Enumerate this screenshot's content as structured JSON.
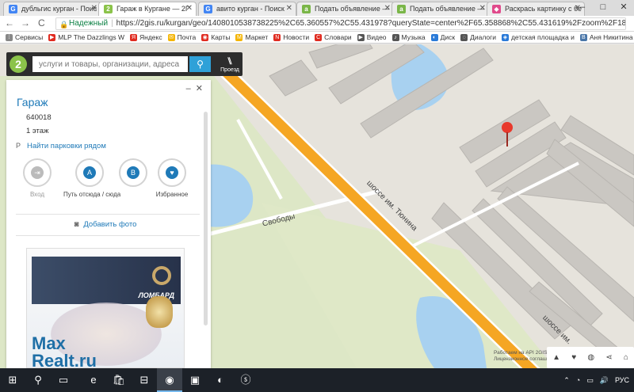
{
  "browser": {
    "tabs": [
      {
        "title": "дубльгис курган - Поис",
        "icon": "google-icon",
        "color": "#4285f4",
        "glyph": "G"
      },
      {
        "title": "Гараж в Кургане — 2Г",
        "icon": "2gis-icon",
        "color": "#8bc34a",
        "glyph": "2"
      },
      {
        "title": "авито курган - Поиск",
        "icon": "google-icon",
        "color": "#4285f4",
        "glyph": "G"
      },
      {
        "title": "Подать объявление —",
        "icon": "avito-icon",
        "color": "#7ab648",
        "glyph": "a"
      },
      {
        "title": "Подать объявление —",
        "icon": "avito-icon",
        "color": "#7ab648",
        "glyph": "a"
      },
      {
        "title": "Раскрась картинку с бе",
        "icon": "paint-icon",
        "color": "#e04a8b",
        "glyph": "◆"
      }
    ],
    "window_buttons": [
      "–",
      "□",
      "✕"
    ],
    "secure_label": "Надежный",
    "url": "https://2gis.ru/kurgan/geo/1408010538738225%2C65.360557%2C55.431978?queryState=center%2F65.358868%2C55.431619%2Fzoom%2F18",
    "nav": {
      "back": "←",
      "forward": "→",
      "reload": "C"
    }
  },
  "bookmarks": [
    {
      "label": "Сервисы",
      "color": "#888888",
      "glyph": "⁞"
    },
    {
      "label": "MLP The Dazzlings W",
      "color": "#e02b20",
      "glyph": "▶"
    },
    {
      "label": "Яндекс",
      "color": "#e02b20",
      "glyph": "Я"
    },
    {
      "label": "Почта",
      "color": "#f4b400",
      "glyph": "✉"
    },
    {
      "label": "Карты",
      "color": "#e02b20",
      "glyph": "◉"
    },
    {
      "label": "Маркет",
      "color": "#f4b400",
      "glyph": "M"
    },
    {
      "label": "Новости",
      "color": "#e02b20",
      "glyph": "N"
    },
    {
      "label": "Словари",
      "color": "#e02b20",
      "glyph": "С"
    },
    {
      "label": "Видео",
      "color": "#555555",
      "glyph": "▶"
    },
    {
      "label": "Музыка",
      "color": "#555555",
      "glyph": "♪"
    },
    {
      "label": "Диск",
      "color": "#2a7ad8",
      "glyph": "◐"
    },
    {
      "label": "Диалоги",
      "color": "#555555",
      "glyph": "◌"
    },
    {
      "label": "детская площадка и",
      "color": "#2a7ad8",
      "glyph": "◈"
    },
    {
      "label": "Аня Никитина",
      "color": "#4a76a8",
      "glyph": "В"
    }
  ],
  "search": {
    "logo": "2",
    "placeholder": "услуги и товары, организации, адреса",
    "button_icon": "search-icon",
    "route_label": "Проезд"
  },
  "panel": {
    "title": "Гараж",
    "postcode": "640018",
    "floor": "1 этаж",
    "parking_prefix": "P",
    "parking_link": "Найти парковки рядом",
    "actions": [
      {
        "label": "Вход",
        "icon": "entrance-icon",
        "glyph": "⇥",
        "enabled": false
      },
      {
        "label": "Путь отсюда / сюда",
        "icon": "route-a-icon",
        "glyph": "A",
        "enabled": true
      },
      {
        "label": "",
        "icon": "route-b-icon",
        "glyph": "B",
        "enabled": true
      },
      {
        "label": "Избранное",
        "icon": "heart-icon",
        "glyph": "♥",
        "enabled": true
      }
    ],
    "add_photo": "Добавить фото",
    "ad_brand": "ЛОМБАРД"
  },
  "map": {
    "streets": [
      "шоссе им. Тюнина",
      "Свободы",
      "шоссе им."
    ],
    "credit_line1": "Работаем на API 2GIS",
    "credit_line2": "Лицензионное соглашение",
    "controls": [
      "▲",
      "♥",
      "◍",
      "⋖",
      "⌂"
    ],
    "colors": {
      "ground": "#e6e3dc",
      "park": "#dfe8c7",
      "water": "#a8d1f0",
      "road": "#f5a623",
      "building": "#c9c6c1",
      "marker": "#e8392c"
    }
  },
  "watermark": {
    "line1": "Max",
    "line2": "Realt.ru"
  },
  "taskbar": {
    "items": [
      "⊞",
      "⚲",
      "▭",
      "e",
      "🛍",
      "⊟",
      "◉",
      "▣",
      "◐",
      "ⓢ"
    ],
    "tray": [
      "⌃",
      "◔",
      "▭",
      "🔊",
      "РУС"
    ]
  }
}
